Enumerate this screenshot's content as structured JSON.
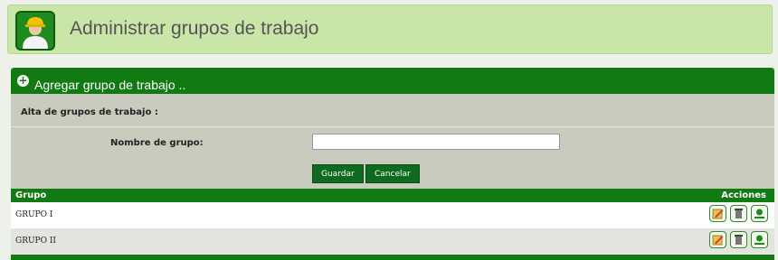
{
  "header": {
    "title": "Administrar grupos de trabajo",
    "avatar_icon": "worker-icon"
  },
  "panel": {
    "title": "Agregar grupo de trabajo ..",
    "expand_icon": "plus-circle-icon",
    "section_label": "Alta de grupos de trabajo :",
    "form": {
      "name_label": "Nombre de grupo:",
      "name_value": "",
      "name_placeholder": "",
      "save_label": "Guardar",
      "cancel_label": "Cancelar"
    }
  },
  "table": {
    "columns": [
      "Grupo",
      "Acciones"
    ],
    "rows": [
      {
        "name": "GRUPO I"
      },
      {
        "name": "GRUPO II"
      }
    ],
    "action_icons": [
      "edit-icon",
      "delete-icon",
      "users-icon"
    ]
  },
  "colors": {
    "header_bg": "#c9e5a8",
    "accent_green": "#127a12",
    "panel_bg": "#c8cbbd",
    "button_green": "#0e6a1e"
  }
}
